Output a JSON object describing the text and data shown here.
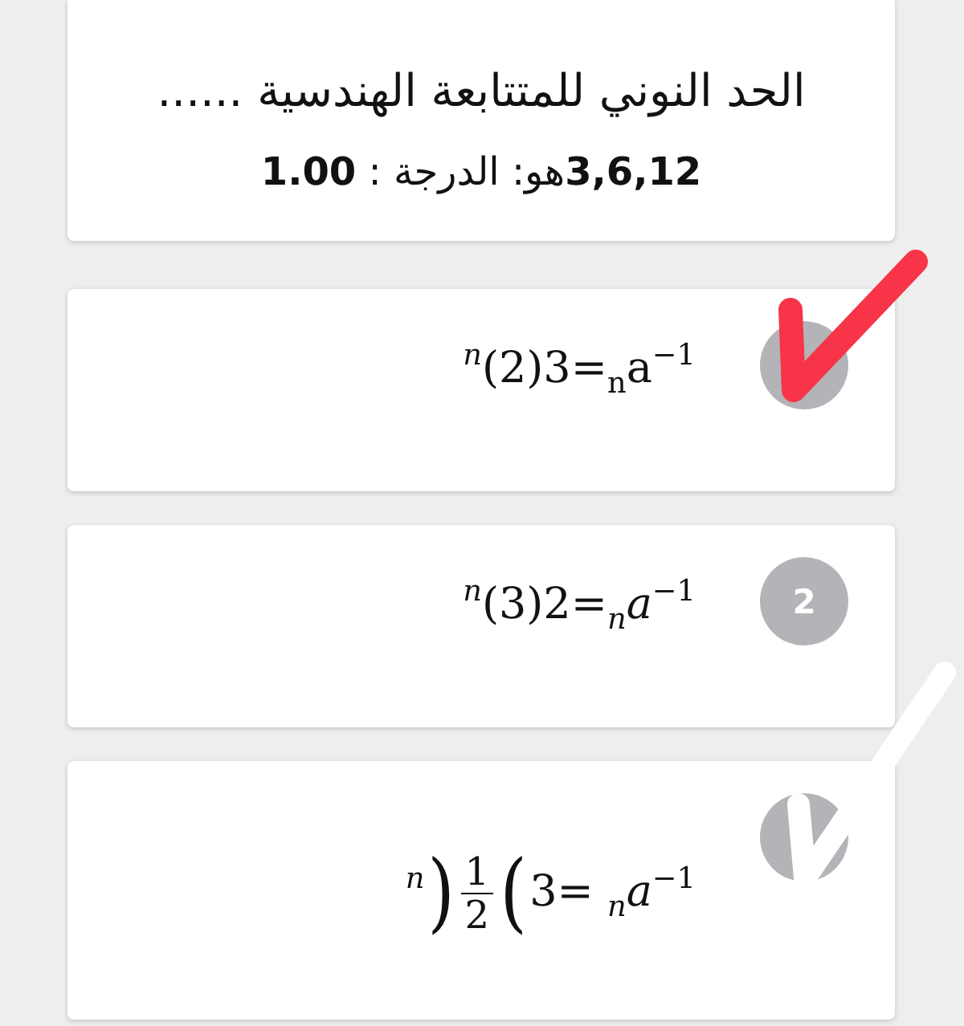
{
  "question": {
    "text": "الحد النوني للمتتابعة الهندسية ......",
    "details": "**3,6,12**هو: الدرجة : **1.00**"
  },
  "options": [
    {
      "formula": {
        "kind": "inline",
        "text": "$^{𝑛}$(2)3=$_{n}$a$^{−1}$"
      },
      "check_mark": {
        "color": "#f73448"
      }
    },
    {
      "formula": {
        "kind": "inline",
        "text": "$^{𝑛}$(3)2=$_{𝑛}$𝑎$^{−1}$"
      },
      "number": "2"
    },
    {
      "formula": {
        "kind": "fraction",
        "before": "$^{𝑛}$",
        "left": ")",
        "numerator": "1",
        "denominator": "2",
        "right": "(",
        "after": "3= $_{𝑛}$𝑎$^{−1}$"
      },
      "check_mark": {
        "color": "#ffffff"
      }
    }
  ]
}
